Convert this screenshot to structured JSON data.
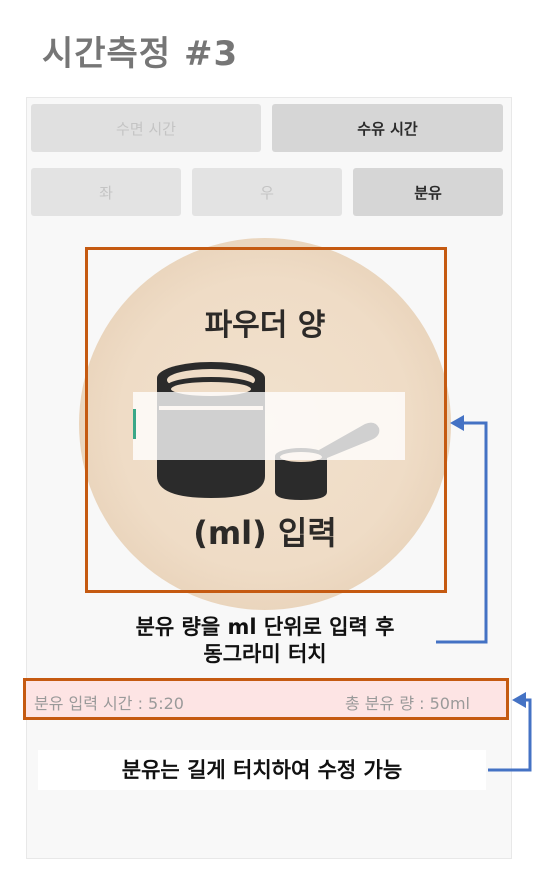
{
  "page_title": "시간측정 #3",
  "mode_tabs": [
    {
      "label": "수면 시간",
      "active": false
    },
    {
      "label": "수유 시간",
      "active": true
    }
  ],
  "side_tabs": [
    {
      "label": "좌",
      "active": false
    },
    {
      "label": "우",
      "active": false
    },
    {
      "label": "분유",
      "active": true
    }
  ],
  "formula_button": {
    "top_text": "파우더 양",
    "bottom_text": "(ml) 입력",
    "icon": "formula-can-icon"
  },
  "amount_input": {
    "value": "",
    "placeholder": ""
  },
  "annotations": {
    "enter_amount_line1": "분유 량을 ml 단위로 입력 후",
    "enter_amount_line2": "동그라미 터치",
    "long_press_hint": "분유는 길게 터치하여 수정 가능"
  },
  "status": {
    "input_time": "분유 입력 시간 : 5:20",
    "total_amount": "총 분유 량 : 50ml"
  },
  "colors": {
    "annotation_box": "#c55a11",
    "arrow": "#4472c4",
    "status_bg": "#fde4e4",
    "circle": "#efdcc6",
    "cursor": "#3aa888"
  }
}
